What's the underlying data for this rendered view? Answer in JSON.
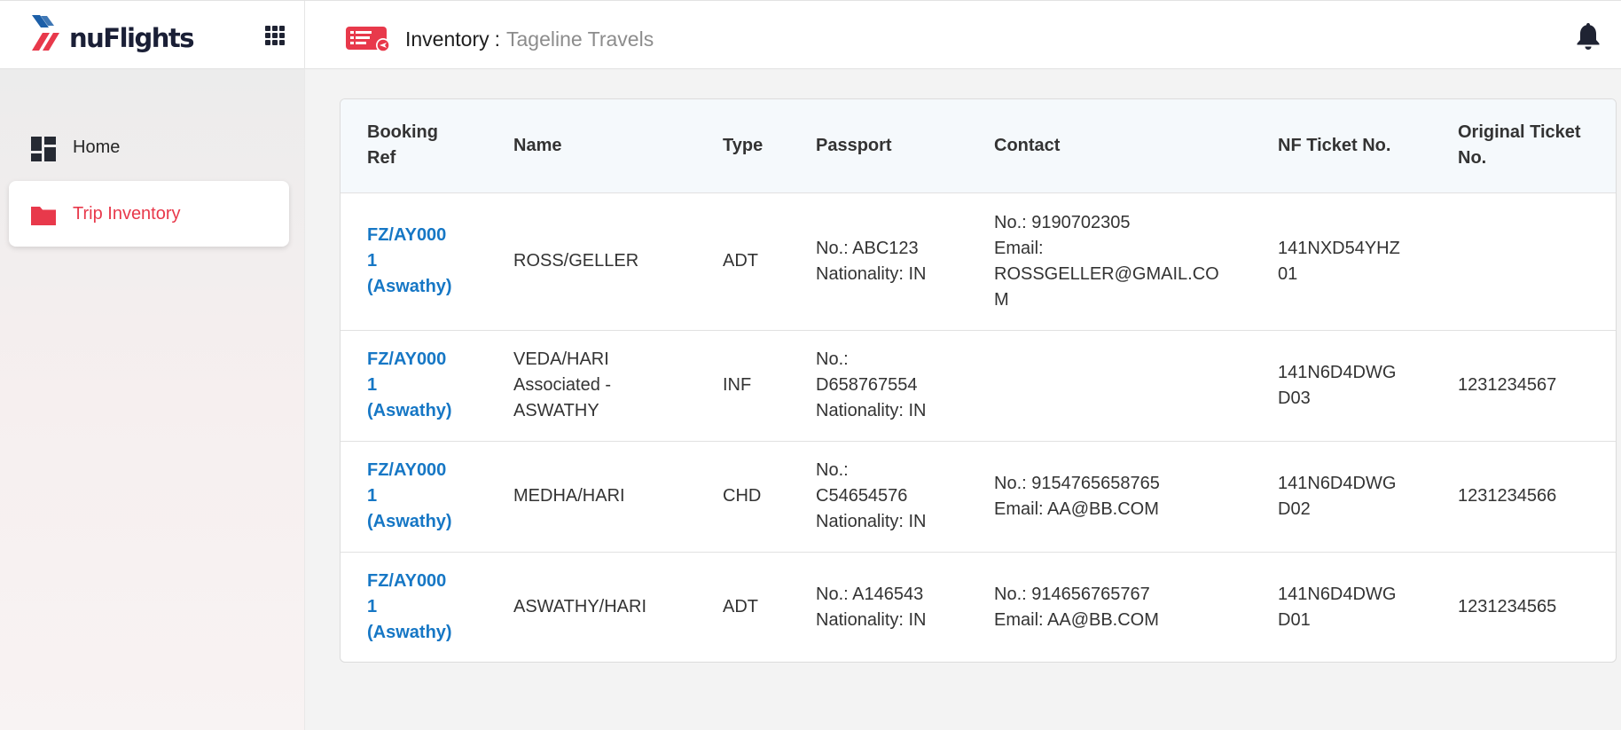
{
  "brand": {
    "name": "nuFlights",
    "accent": "#e8394b",
    "accent_dark": "#1a1f36"
  },
  "header": {
    "title": "Inventory",
    "separator": ":",
    "subtitle": "Tageline Travels",
    "icons": [
      "apps-grid-icon",
      "ticket-icon",
      "bell-icon"
    ]
  },
  "sidebar": {
    "items": [
      {
        "label": "Home",
        "icon": "dashboard-icon",
        "active": false
      },
      {
        "label": "Trip Inventory",
        "icon": "folder-icon",
        "active": true
      }
    ]
  },
  "table": {
    "columns": [
      "Booking\nRef",
      "Name",
      "Type",
      "Passport",
      "Contact",
      "NF Ticket No.",
      "Original Ticket\nNo."
    ],
    "rows": [
      {
        "booking_ref": "FZ/AY000\n1\n(Aswathy)",
        "name": "ROSS/GELLER",
        "type": "ADT",
        "passport": "No.: ABC123\nNationality: IN",
        "contact": "No.: 9190702305\nEmail:\nROSSGELLER@GMAIL.CO\nM",
        "nf_ticket": "141NXD54YHZ\n01",
        "original_ticket": ""
      },
      {
        "booking_ref": "FZ/AY000\n1\n(Aswathy)",
        "name": "VEDA/HARI\nAssociated -\nASWATHY",
        "type": "INF",
        "passport": "No.:\nD658767554\nNationality: IN",
        "contact": "",
        "nf_ticket": "141N6D4DWG\nD03",
        "original_ticket": "1231234567"
      },
      {
        "booking_ref": "FZ/AY000\n1\n(Aswathy)",
        "name": "MEDHA/HARI",
        "type": "CHD",
        "passport": "No.:\nC54654576\nNationality: IN",
        "contact": "No.: 9154765658765\nEmail: AA@BB.COM",
        "nf_ticket": "141N6D4DWG\nD02",
        "original_ticket": "1231234566"
      },
      {
        "booking_ref": "FZ/AY000\n1\n(Aswathy)",
        "name": "ASWATHY/HARI",
        "type": "ADT",
        "passport": "No.: A146543\nNationality: IN",
        "contact": "No.: 914656765767\nEmail: AA@BB.COM",
        "nf_ticket": "141N6D4DWG\nD01",
        "original_ticket": "1231234565"
      }
    ]
  }
}
